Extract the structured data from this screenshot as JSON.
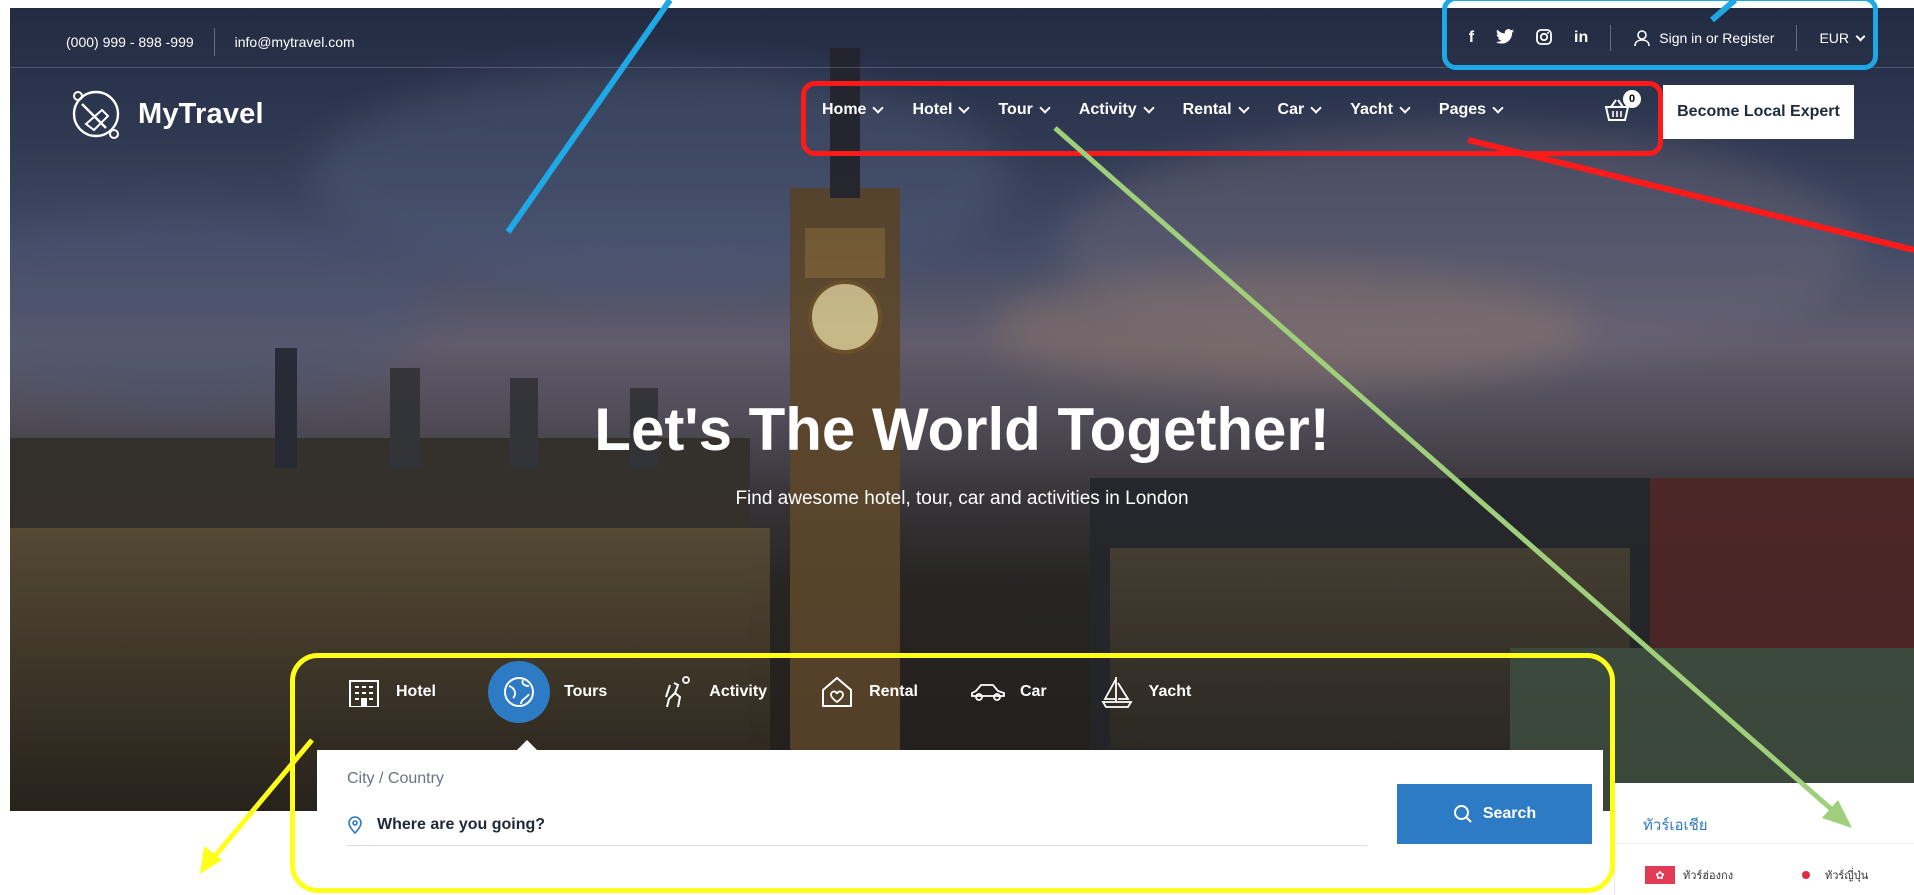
{
  "topbar": {
    "phone": "(000) 999 - 898 -999",
    "email": "info@mytravel.com",
    "social": [
      "f",
      "twitter",
      "instagram",
      "in"
    ],
    "signin": "Sign in or Register",
    "currency": "EUR"
  },
  "brand": {
    "name": "MyTravel"
  },
  "nav": {
    "items": [
      {
        "label": "Home"
      },
      {
        "label": "Hotel"
      },
      {
        "label": "Tour"
      },
      {
        "label": "Activity"
      },
      {
        "label": "Rental"
      },
      {
        "label": "Car"
      },
      {
        "label": "Yacht"
      },
      {
        "label": "Pages"
      }
    ],
    "cart_count": "0",
    "cta": "Become Local Expert"
  },
  "hero": {
    "title": "Let's The World Together!",
    "subtitle": "Find awesome hotel, tour, car and activities in London"
  },
  "search": {
    "tabs": [
      {
        "label": "Hotel",
        "icon": "hotel-building-icon"
      },
      {
        "label": "Tours",
        "icon": "globe-pin-icon",
        "active": true
      },
      {
        "label": "Activity",
        "icon": "hiker-icon"
      },
      {
        "label": "Rental",
        "icon": "house-heart-icon"
      },
      {
        "label": "Car",
        "icon": "car-icon"
      },
      {
        "label": "Yacht",
        "icon": "sailboat-icon"
      }
    ],
    "field_label": "City / Country",
    "placeholder": "Where are you going?",
    "button": "Search"
  },
  "widget": {
    "title": "ทัวร์เอเชีย",
    "chips": [
      {
        "label": "ทัวร์ฮ่องกง",
        "icon": "hong-kong-flag-icon"
      },
      {
        "label": "ทัวร์ญี่ปุ่น",
        "icon": "japan-flag-icon"
      }
    ]
  },
  "annotation_colors": {
    "topbar_box": "#1fa8e6",
    "nav_box": "#ff1a1a",
    "search_box": "#ffff1a",
    "arrow_green": "#9fcf7a"
  }
}
